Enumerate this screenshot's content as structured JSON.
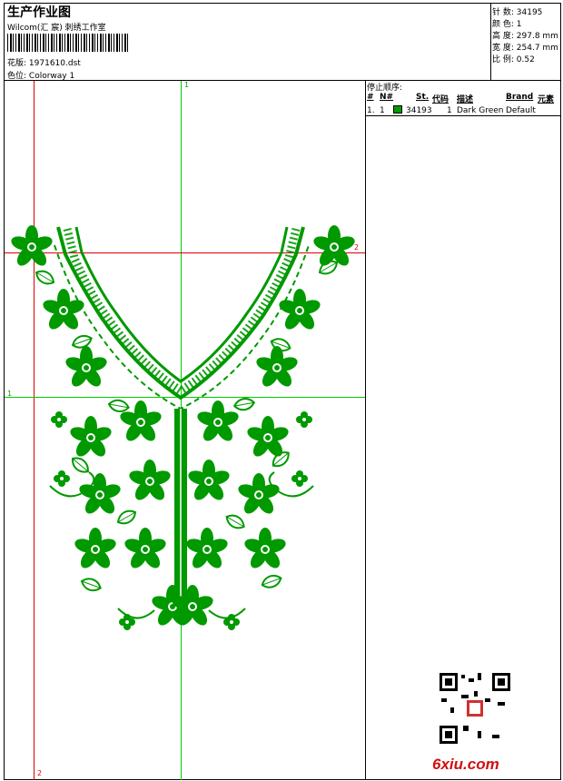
{
  "header": {
    "title": "生产作业图",
    "studio": "Wilcom(汇 宸) 刺绣工作室",
    "design_label": "花版:",
    "design_value": "1971610.dst",
    "colorway_label": "色位:",
    "colorway_value": "Colorway 1"
  },
  "stats": [
    {
      "label": "针 数:",
      "value": "34195"
    },
    {
      "label": "颜 色:",
      "value": "1"
    },
    {
      "label": "高 度:",
      "value": "297.8 mm"
    },
    {
      "label": "宽 度:",
      "value": "254.7 mm"
    },
    {
      "label": "比 例:",
      "value": "0.52"
    }
  ],
  "stop_sequence": {
    "title": "停止顺序:",
    "headers": {
      "num": "#",
      "n": "N#",
      "st": "St.",
      "code": "代码",
      "desc": "描述",
      "brand": "Brand",
      "element": "元素"
    },
    "rows": [
      {
        "num": "1.",
        "n": "1",
        "color": "#009900",
        "st": "34193",
        "code": "1",
        "desc": "Dark Green",
        "brand": "Default"
      }
    ]
  },
  "guides": {
    "v1": "1",
    "h2": "2",
    "h1": "1",
    "v2": "2"
  },
  "watermark": "6xiu.com",
  "colors": {
    "thread": "#009900",
    "guide_green": "#00cc00",
    "guide_red": "#dd0000"
  }
}
